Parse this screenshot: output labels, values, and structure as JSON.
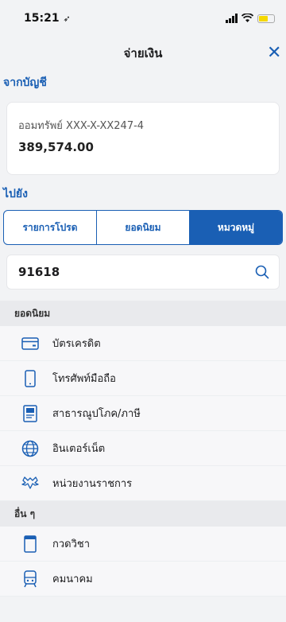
{
  "status": {
    "time": "15:21",
    "location_glyph": "➶"
  },
  "nav": {
    "title": "จ่ายเงิน",
    "close_glyph": "✕"
  },
  "from": {
    "section_label": "จากบัญชี",
    "account_name": "ออมทรัพย์ XXX-X-XX247-4",
    "balance": "389,574.00"
  },
  "to": {
    "section_label": "ไปยัง",
    "tabs": [
      {
        "label": "รายการโปรด"
      },
      {
        "label": "ยอดนิยม"
      },
      {
        "label": "หมวดหมู่"
      }
    ],
    "active_tab": 2
  },
  "search": {
    "value": "91618"
  },
  "groups": {
    "popular": {
      "header": "ยอดนิยม",
      "items": [
        {
          "label": "บัตรเครดิต",
          "icon": "credit-card-icon"
        },
        {
          "label": "โทรศัพท์มือถือ",
          "icon": "mobile-phone-icon"
        },
        {
          "label": "สาธารณูปโภค/ภาษี",
          "icon": "utility-bill-icon"
        },
        {
          "label": "อินเตอร์เน็ต",
          "icon": "globe-icon"
        },
        {
          "label": "หน่วยงานราชการ",
          "icon": "government-emblem-icon"
        }
      ]
    },
    "other": {
      "header": "อื่น ๆ",
      "items": [
        {
          "label": "กวดวิชา",
          "icon": "book-icon"
        },
        {
          "label": "คมนาคม",
          "icon": "train-icon"
        }
      ]
    }
  },
  "colors": {
    "accent": "#1a5fb4",
    "background": "#f2f3f5"
  }
}
